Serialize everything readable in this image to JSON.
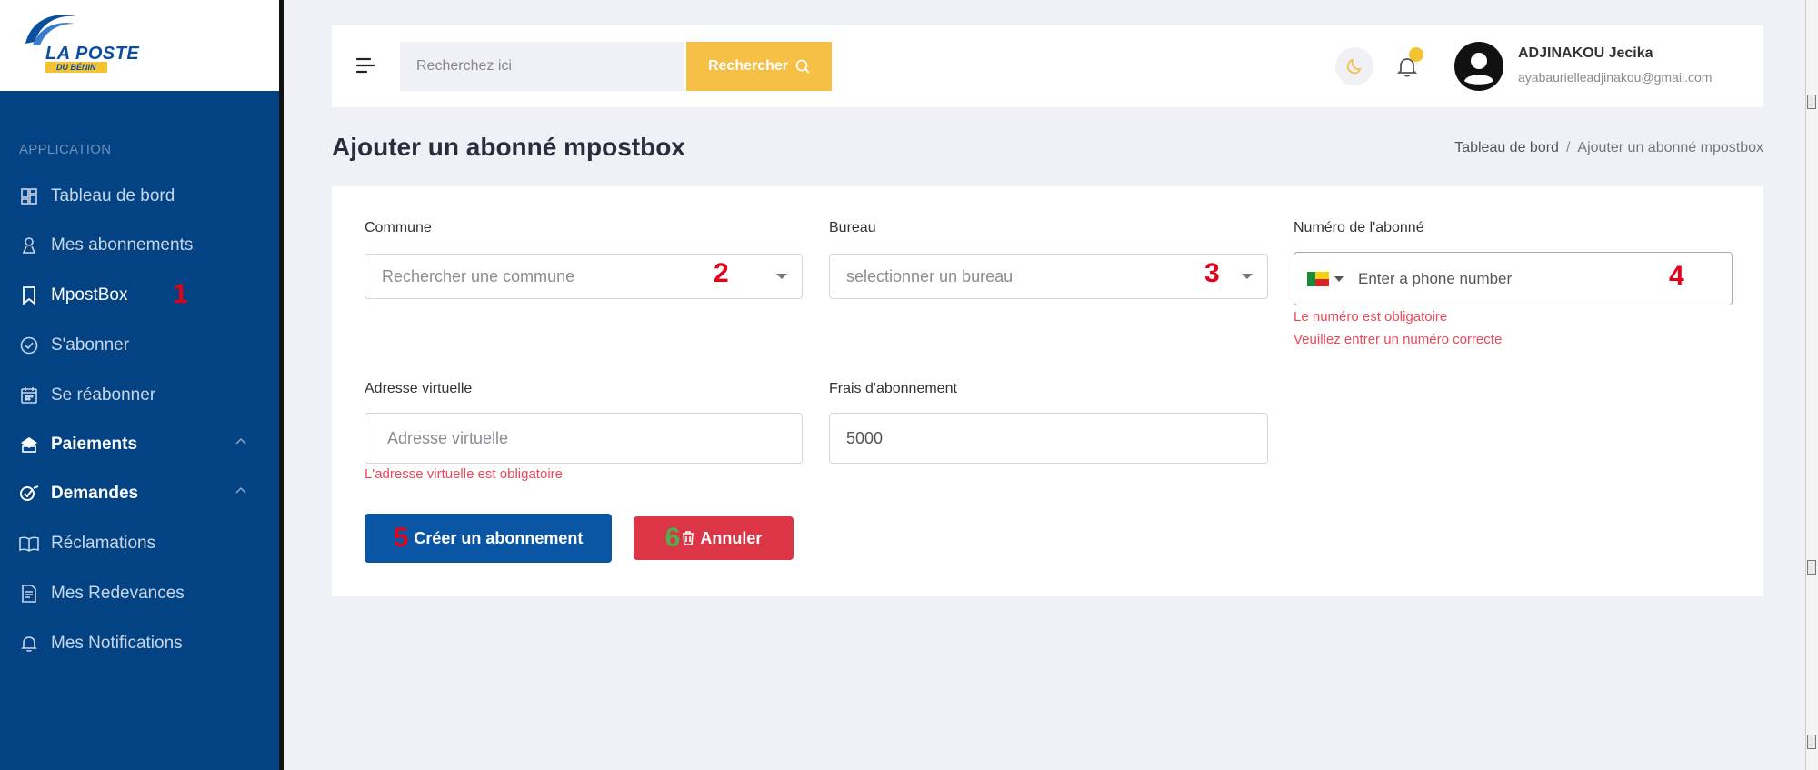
{
  "sidebar": {
    "logo": {
      "title": "LA POSTE",
      "subtitle": "DU BÉNIN"
    },
    "section_label": "APPLICATION",
    "items": [
      {
        "label": "Tableau de bord",
        "icon": "dashboard-icon"
      },
      {
        "label": "Mes abonnements",
        "icon": "subscriptions-icon"
      },
      {
        "label": "MpostBox",
        "icon": "bookmark-icon",
        "annotation": "1"
      },
      {
        "label": "S'abonner",
        "icon": "check-circle-icon"
      },
      {
        "label": "Se réabonner",
        "icon": "calendar-icon"
      },
      {
        "label": "Paiements",
        "icon": "payment-icon"
      },
      {
        "label": "Demandes",
        "icon": "requests-icon"
      },
      {
        "label": "Réclamations",
        "icon": "book-icon"
      },
      {
        "label": "Mes Redevances",
        "icon": "document-icon"
      },
      {
        "label": "Mes Notifications",
        "icon": "bell-icon"
      }
    ]
  },
  "header": {
    "search_placeholder": "Recherchez ici",
    "search_button": "Rechercher",
    "user_name": "ADJINAKOU Jecika",
    "user_email": "ayabaurielleadjinakou@gmail.com"
  },
  "page": {
    "title": "Ajouter un abonné mpostbox",
    "breadcrumb": {
      "home": "Tableau de bord",
      "separator": "/",
      "current": "Ajouter un abonné mpostbox"
    }
  },
  "form": {
    "commune": {
      "label": "Commune",
      "placeholder": "Rechercher une commune",
      "annotation": "2"
    },
    "bureau": {
      "label": "Bureau",
      "placeholder": "selectionner un bureau",
      "annotation": "3"
    },
    "numero": {
      "label": "Numéro de l'abonné",
      "placeholder": "Enter a phone number",
      "annotation": "4",
      "errors": [
        "Le numéro est obligatoire",
        "Veuillez entrer un numéro correcte"
      ]
    },
    "adresse": {
      "label": "Adresse virtuelle",
      "placeholder": "Adresse virtuelle",
      "error": "L'adresse virtuelle est obligatoire"
    },
    "frais": {
      "label": "Frais d'abonnement",
      "value": "5000"
    },
    "submit": {
      "label": "Créer un abonnement",
      "annotation": "5"
    },
    "cancel": {
      "label": "Annuler",
      "annotation": "6"
    }
  },
  "colors": {
    "sidebar": "#034383",
    "accent": "#f5c045",
    "primary": "#0a56a4",
    "danger": "#dc3545",
    "error": "#e84a5a",
    "annotation": "#e3001b",
    "annotation_green": "#4caf50"
  }
}
